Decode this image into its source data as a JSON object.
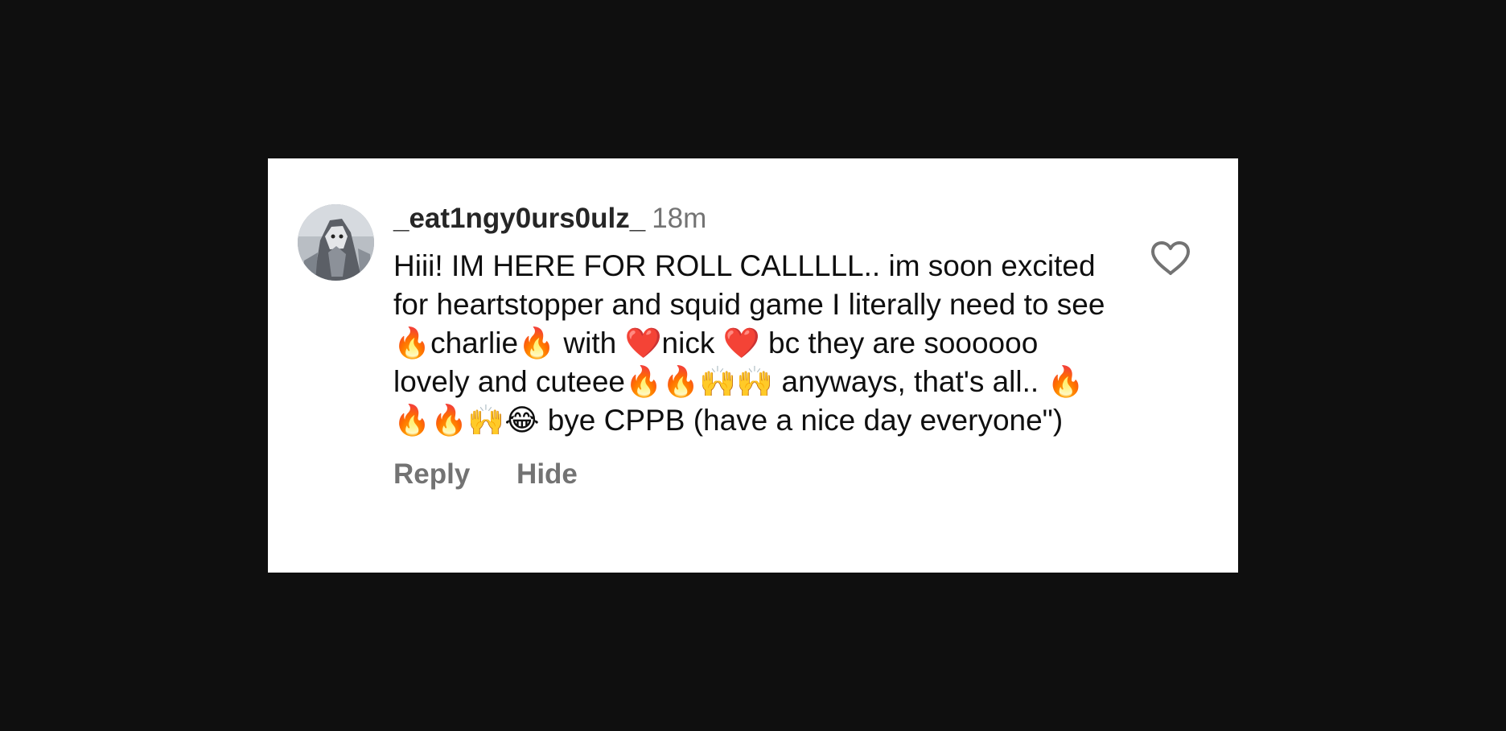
{
  "colors": {
    "background": "#0f0f0f",
    "card": "#ffffff",
    "username": "#262626",
    "muted": "#737373",
    "text": "#0f0f0f"
  },
  "comment": {
    "username": "_eat1ngy0urs0ulz_",
    "timestamp": "18m",
    "text": "Hiii! IM HERE FOR ROLL CALLLLL.. im soon excited for heartstopper and squid game I literally need to see 🔥charlie🔥 with ❤️nick ❤️ bc they are soooooo lovely and cuteee🔥🔥🙌🙌 anyways, that's all.. 🔥🔥🔥🙌😂 bye CPPB (have a nice day everyone\")",
    "actions": {
      "reply": "Reply",
      "hide": "Hide"
    },
    "avatar_icon": "user-avatar-cat-photo",
    "like_icon": "heart-outline-icon"
  }
}
